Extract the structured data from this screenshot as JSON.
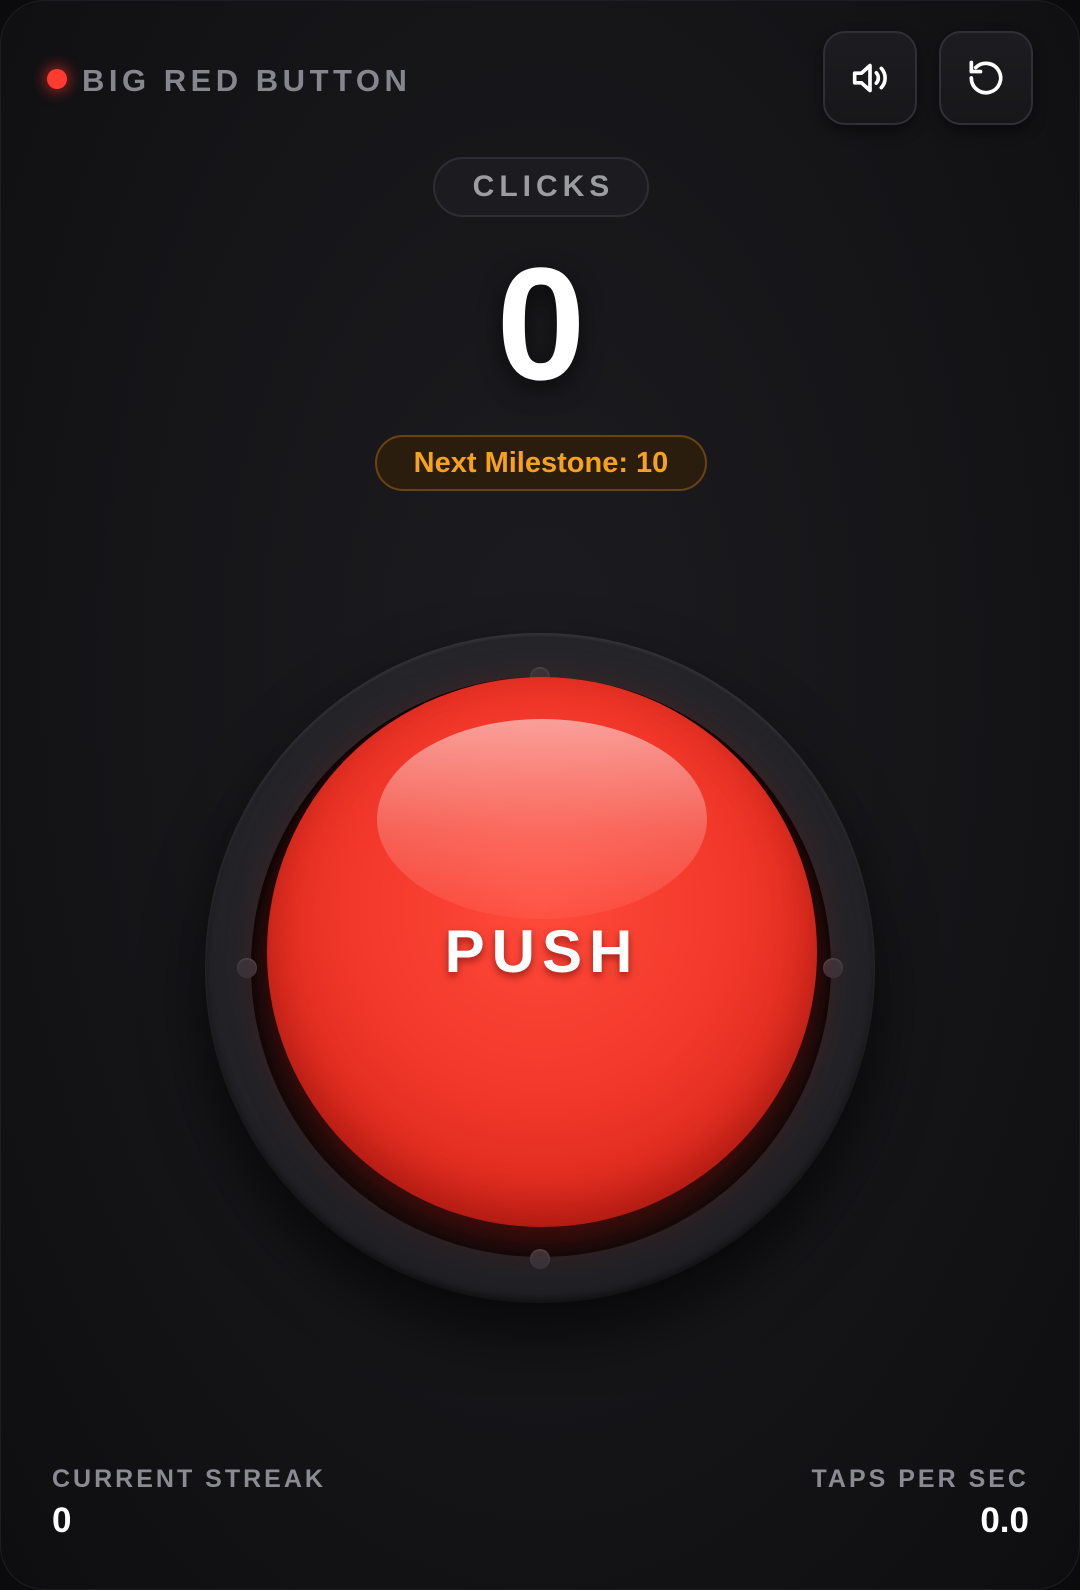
{
  "header": {
    "title": "BIG RED BUTTON",
    "status_color": "#ff3b30",
    "sound_button_icon": "speaker-volume-icon",
    "reset_button_icon": "reset-rotate-icon"
  },
  "counter": {
    "label": "CLICKS",
    "value": "0",
    "milestone": "Next Milestone: 10",
    "milestone_color": "#f6a21c"
  },
  "button": {
    "label": "PUSH",
    "color": "#f2382a"
  },
  "stats": {
    "streak_label": "CURRENT STREAK",
    "streak_value": "0",
    "tps_label": "TAPS PER SEC",
    "tps_value": "0.0"
  }
}
